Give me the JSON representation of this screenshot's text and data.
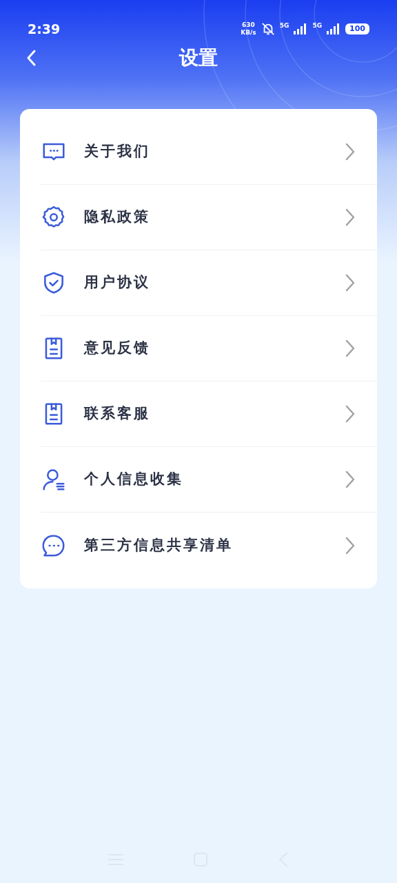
{
  "status_bar": {
    "time": "2:39",
    "speed_value": "630",
    "speed_unit": "KB/s",
    "network_1": "5G",
    "network_2": "5G",
    "battery": "100"
  },
  "header": {
    "title": "设置"
  },
  "menu": [
    {
      "label": "关于我们",
      "kind": "message"
    },
    {
      "label": "隐私政策",
      "kind": "gear"
    },
    {
      "label": "用户协议",
      "kind": "shield"
    },
    {
      "label": "意见反馈",
      "kind": "document"
    },
    {
      "label": "联系客服",
      "kind": "document"
    },
    {
      "label": "个人信息收集",
      "kind": "user"
    },
    {
      "label": "第三方信息共享清单",
      "kind": "chat"
    }
  ]
}
